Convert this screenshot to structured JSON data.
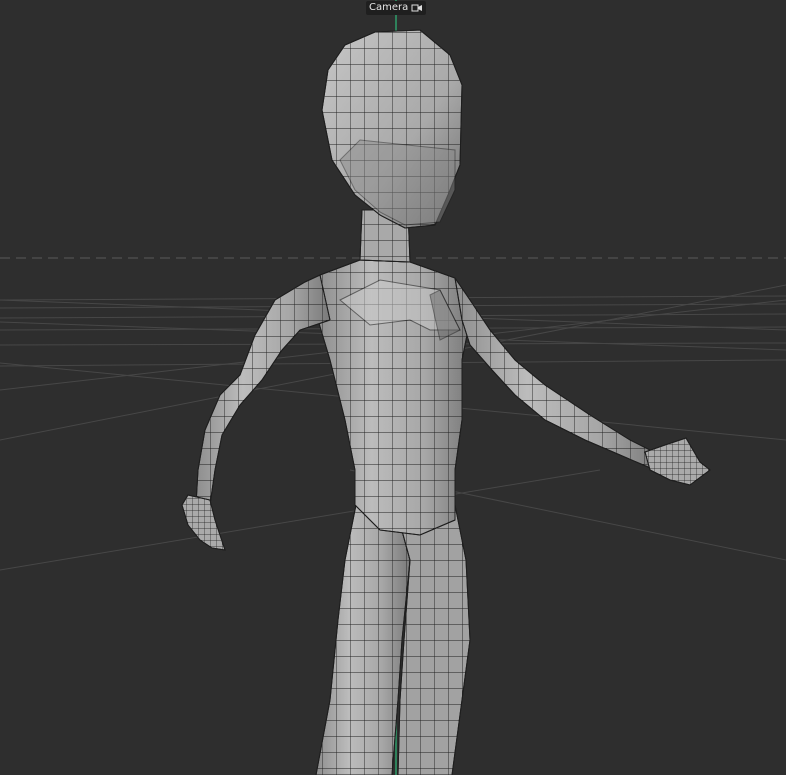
{
  "viewport": {
    "camera_name": "Camera",
    "camera_icon": "camera-view-icon",
    "object": "character-base-mesh",
    "view": "perspective",
    "colors": {
      "background": "#2e2e2e",
      "grid_line": "#4a4a4a",
      "horizon_line": "#555555",
      "axis_green": "#2f9e6a",
      "mesh_light": "#b9b9b9",
      "mesh_mid": "#9a9a9a",
      "mesh_dark": "#6f6f6f",
      "wire": "#1e1e1e"
    }
  }
}
